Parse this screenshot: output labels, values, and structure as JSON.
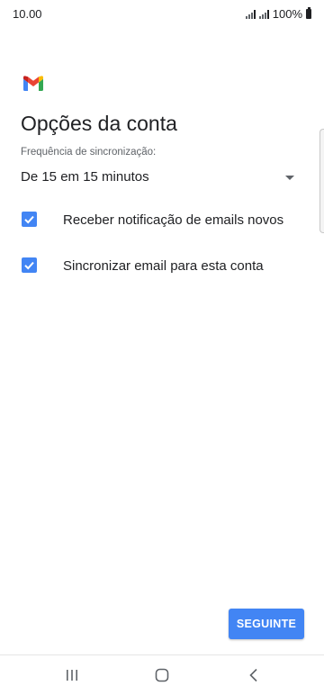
{
  "status_bar": {
    "time": "10.00",
    "battery_text": "100%"
  },
  "logo": {
    "icon": "gmail-logo",
    "colors": {
      "red": "#ea4335",
      "blue": "#4285f4",
      "green": "#34a853",
      "yellow": "#fbbc04",
      "dark_red": "#c5221f"
    }
  },
  "page": {
    "title": "Opções da conta"
  },
  "sync": {
    "label": "Frequência de sincronização:",
    "selected_value": "De 15 em 15 minutos"
  },
  "options": [
    {
      "label": "Receber notificação de emails novos",
      "checked": true
    },
    {
      "label": "Sincronizar email para esta conta",
      "checked": true
    }
  ],
  "actions": {
    "next_label": "SEGUINTE"
  },
  "nav": {
    "recent_icon": "recent-apps-icon",
    "home_icon": "home-icon",
    "back_icon": "back-icon"
  },
  "theme": {
    "accent": "#4285f4",
    "text": "#202124",
    "secondary_text": "#5f6368"
  }
}
